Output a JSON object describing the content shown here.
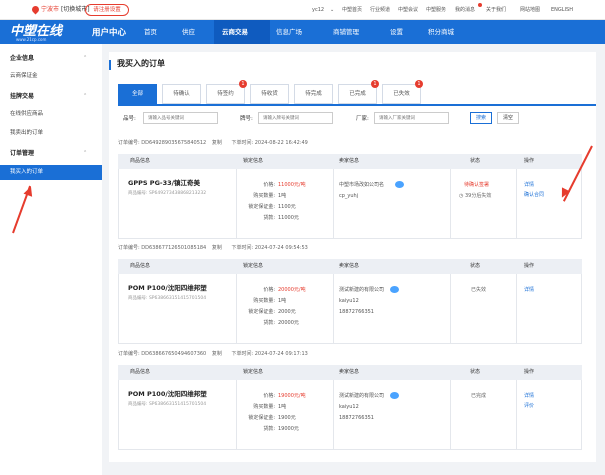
{
  "topbar": {
    "city_prefix": "宁波市",
    "city_suffix": "[切换城市]",
    "login": "请注册设置",
    "user": "yc12",
    "links": [
      "中塑首页",
      "行业频道",
      "中塑会议",
      "中塑服务",
      "我的消息",
      "关于我们",
      "网站地图",
      "ENGLISH"
    ]
  },
  "nav": {
    "logo": "中塑在线",
    "logo_sub": "www.21cp.com",
    "user_center": "用户中心",
    "items": [
      "首页",
      "供应",
      "云商交易",
      "信息广场",
      "商铺管理",
      "设置",
      "积分商城"
    ],
    "active": "云商交易"
  },
  "sidebar": {
    "groups": [
      {
        "title": "企业信息",
        "items": [
          "云商保证金"
        ]
      },
      {
        "title": "挂牌交易",
        "items": [
          "在线供应商品",
          "我卖出的订单"
        ]
      },
      {
        "title": "订单管理",
        "items": [
          "我买入的订单"
        ]
      }
    ]
  },
  "page": {
    "title": "我买入的订单"
  },
  "tabs": [
    {
      "label": "全部",
      "badge": ""
    },
    {
      "label": "待确认",
      "badge": ""
    },
    {
      "label": "待签约",
      "badge": "1"
    },
    {
      "label": "待收货",
      "badge": ""
    },
    {
      "label": "待完成",
      "badge": ""
    },
    {
      "label": "已完成",
      "badge": "1"
    },
    {
      "label": "已失效",
      "badge": "1"
    }
  ],
  "filters": {
    "product_label": "品号:",
    "product_placeholder": "请输入品号关键词",
    "brand_label": "牌号:",
    "brand_placeholder": "请输入牌号关键词",
    "factory_label": "厂家:",
    "factory_placeholder": "请输入厂家关键词",
    "search": "搜索",
    "clear": "清空"
  },
  "columns": {
    "product": "商品信息",
    "lock": "锁定信息",
    "seller": "卖家信息",
    "status": "状态",
    "action": "操作"
  },
  "lock_labels": {
    "price": "价格:",
    "qty": "购买数量:",
    "deposit": "锁定保证金:",
    "payment": "货款:"
  },
  "orders": [
    {
      "order_label": "订单编号:",
      "order_no": "DD649289035675840512",
      "copy": "复制",
      "time_label": "下单时间:",
      "time": "2024-08-22 16:42:49",
      "product_name": "GPPS PG-33/镇江奇美",
      "product_no": "商品编号: SP649273438868213232",
      "price": "11000元/吨",
      "qty": "1吨",
      "deposit": "1100元",
      "payment": "11000元",
      "seller_company": "中塑市场改如公司名",
      "seller_contact": "cp_yuhj",
      "seller_phone": "",
      "status": "待确认签署",
      "status_sub": "39分后失效",
      "actions": [
        "详情",
        "确认合同"
      ]
    },
    {
      "order_label": "订单编号:",
      "order_no": "DD638677126501085184",
      "copy": "复制",
      "time_label": "下单时间:",
      "time": "2024-07-24 09:54:53",
      "product_name": "POM P100/沈阳四维邦塑",
      "product_no": "商品编号: SP638663151415701504",
      "price": "20000元/吨",
      "qty": "1吨",
      "deposit": "2000元",
      "payment": "20000元",
      "seller_company": "测试新建的有限公司",
      "seller_contact": "kaiyu12",
      "seller_phone": "18872766351",
      "status": "已失效",
      "status_sub": "",
      "actions": [
        "详情"
      ]
    },
    {
      "order_label": "订单编号:",
      "order_no": "DD638667650494607360",
      "copy": "复制",
      "time_label": "下单时间:",
      "time": "2024-07-24 09:17:13",
      "product_name": "POM P100/沈阳四维邦塑",
      "product_no": "商品编号: SP638663151415701504",
      "price": "19000元/吨",
      "qty": "1吨",
      "deposit": "1900元",
      "payment": "19000元",
      "seller_company": "测试新建的有限公司",
      "seller_contact": "kaiyu12",
      "seller_phone": "18872766351",
      "status": "已完成",
      "status_sub": "",
      "actions": [
        "详情",
        "评价"
      ]
    }
  ]
}
